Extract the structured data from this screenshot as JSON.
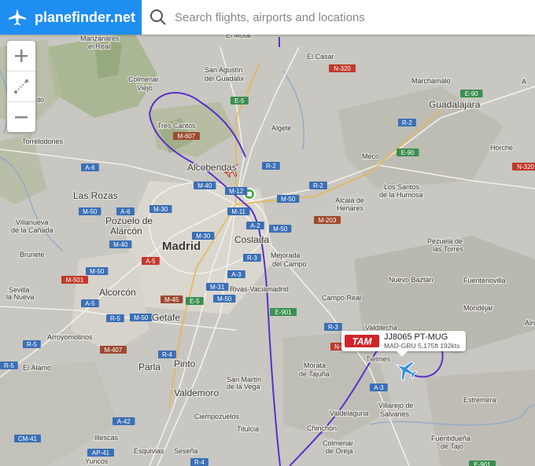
{
  "brand": {
    "name": "planefinder.net",
    "logo_icon": "plane-icon",
    "color": "#1f8ef1"
  },
  "search": {
    "placeholder": "Search flights, airports and locations",
    "value": "",
    "icon": "search-icon"
  },
  "map_controls": {
    "zoom_in_icon": "plus-icon",
    "measure_icon": "ruler-icon",
    "zoom_out_icon": "minus-icon"
  },
  "flight": {
    "callsign": "JJ8065 PT-MUG",
    "route_info": "MAD-GRU 5,175ft 192kts",
    "airline_logo": "TAM",
    "airline_color": "#d2232a",
    "track_color": "#5a2fc9",
    "marker_color": "#2f8de4"
  },
  "places": {
    "el_molar": "El Molar",
    "el_casar": "El Casar",
    "manzanares": "Manzanares",
    "el_real": "el Real",
    "colmenar": "Colmenar",
    "viejo": "Viejo",
    "san_agustin": "San Agustín",
    "del_guadalix": "del Guadalix",
    "marchamalo": "Marchamalo",
    "guadalajara": "Guadalajara",
    "tres_cantos": "Tres Cantos",
    "algete": "Algete",
    "torrelodones": "Torrelodones",
    "meco": "Meco",
    "horche": "Horche",
    "alcobendas": "Alcobendas",
    "las_rozas": "Las Rozas",
    "los_santos": "Los Santos",
    "de_la_humosa": "de la Humosa",
    "alcala": "Alcalá de",
    "henares": "Henares",
    "villanueva": "Villanueva",
    "de_la_canada": "de la Cañada",
    "pozuelo": "Pozuelo de",
    "alarcon": "Alarcón",
    "coslada": "Coslada",
    "madrid": "Madrid",
    "brunete": "Brunete",
    "mejorada": "Mejorada",
    "del_campo": "del Campo",
    "pezuela": "Pezuela de",
    "las_torres": "las Torres",
    "nuevo_baztan": "Nuevo Baztán",
    "fuentenovilla": "Fuentenovilla",
    "sevilla": "Sevilla",
    "la_nueva": "la Nueva",
    "alcorcon": "Alcorcón",
    "rivas": "Rivas-Vaciamadrid",
    "campo_real": "Campo Real",
    "mondejar": "Mondéjar",
    "getafe": "Getafe",
    "valdilecha": "Valdilecha",
    "arroyomolinos": "Arroyomolinos",
    "tielmes": "Tielmes",
    "parla": "Parla",
    "pinto": "Pinto",
    "morata": "Morata",
    "de_tajuna": "de Tajuña",
    "el_alamo": "El Álamo",
    "san_martin": "San Martín",
    "de_la_vega": "de la Vega",
    "valdemoro": "Valdemoro",
    "valdelaguna": "Valdelaguna",
    "villarejo": "Villarejo de",
    "salvanes": "Salvanés",
    "estremera": "Estremera",
    "ciempozuelos": "Ciempozuelos",
    "titulcia": "Titulcia",
    "chinchon": "Chinchón",
    "illescas": "Illescas",
    "colmenar_de": "Colmenar",
    "de_oreja": "de Oreja",
    "fuentiduena": "Fuentidueña",
    "de_tajo": "de Tajo",
    "esquivias": "Esquivias",
    "senena": "Seseña",
    "yuncos": "Yuncos",
    "partial_a": "A",
    "partial_aln": "Aln",
    "partial_do": "do"
  },
  "roads": {
    "n320a": "N-320",
    "e5a": "E-5",
    "r2a": "R-2",
    "e90a": "E-90",
    "e90b": "E-90",
    "n320b": "N-320",
    "m607": "M-607",
    "a6a": "A-6",
    "r2b": "R-2",
    "r2c": "R-2",
    "m40a": "M-40",
    "m12": "M-12",
    "m50a": "M-50",
    "m50b": "M-50",
    "a6b": "A-6",
    "m30a": "M-30",
    "m11": "M-11",
    "m203": "M-203",
    "m40b": "M-40",
    "a2": "A-2",
    "m50c": "M-50",
    "m30b": "M-30",
    "r3": "R-3",
    "a5": "A-5",
    "m50d": "M-50",
    "a3": "A-3",
    "m501": "M-501",
    "m31": "M-31",
    "m45": "M-45",
    "e5b": "E-5",
    "m50e": "M-50",
    "a5b": "A-5",
    "r5a": "R-5",
    "m50f": "M-50",
    "e901": "E-901",
    "r3b": "R-3",
    "n3": "N-3",
    "m407": "M-407",
    "r4": "R-4",
    "r5b": "R-5",
    "a3b": "A-3",
    "a42": "A-42",
    "cm41": "CM-41",
    "ap41": "AP-41",
    "r4b": "R-4",
    "e901b": "E-901",
    "r5c": "R-5"
  }
}
